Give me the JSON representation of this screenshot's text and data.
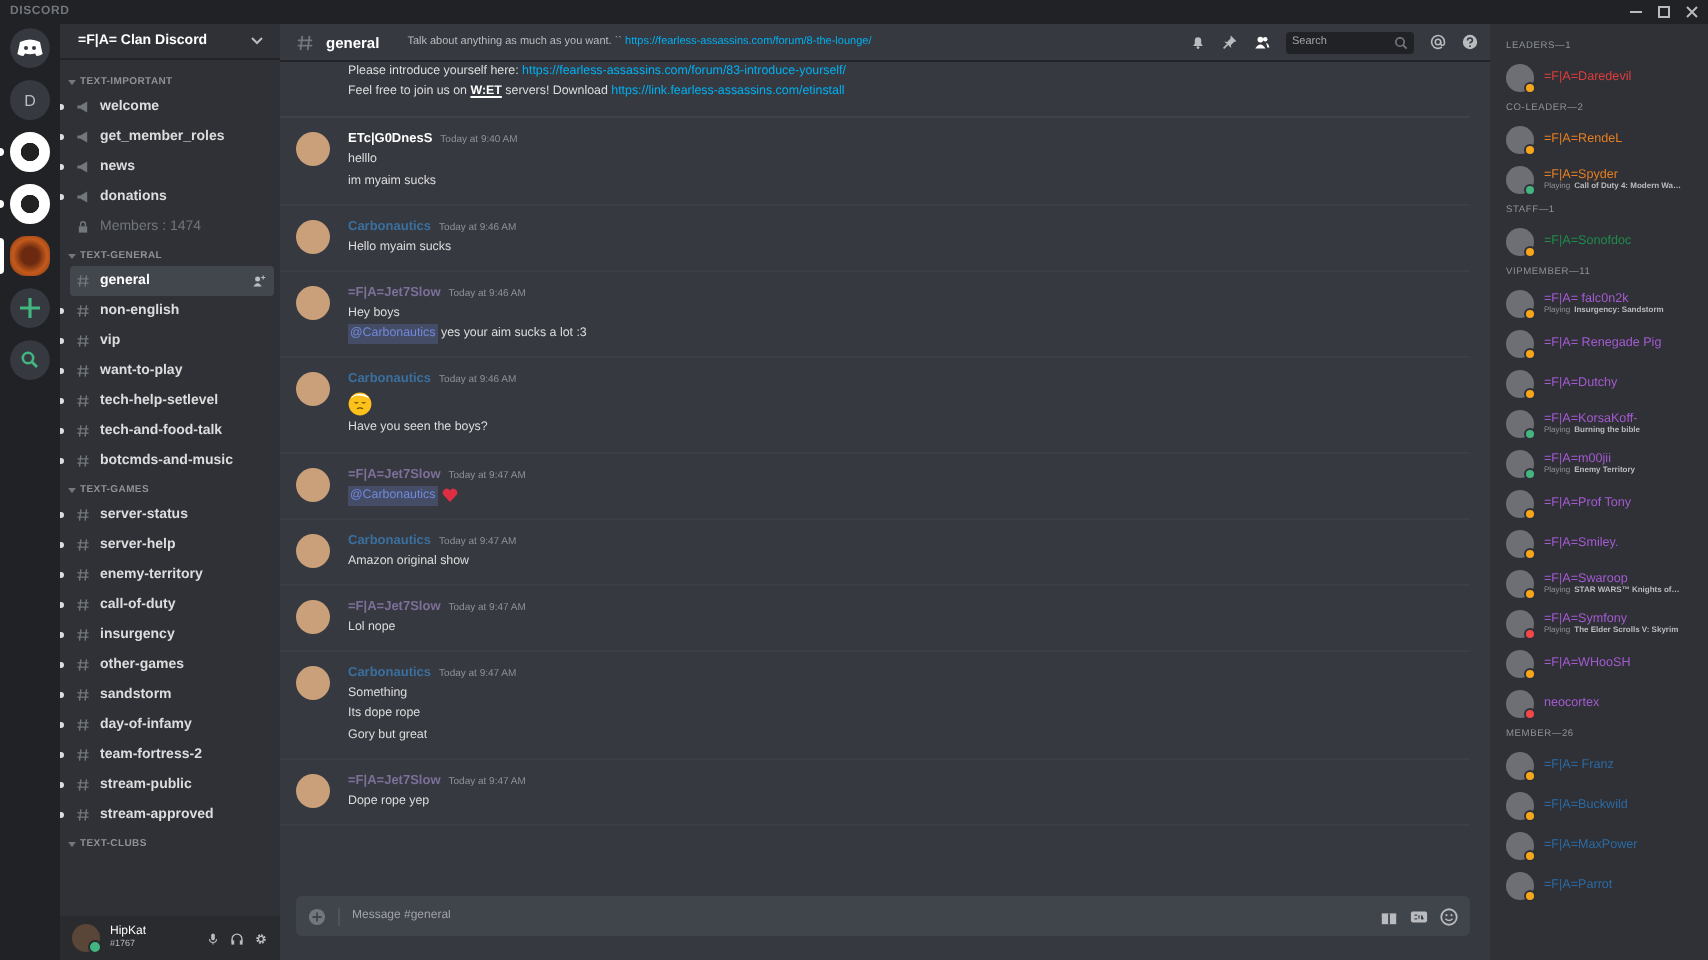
{
  "app_title": "DISCORD",
  "servers": [
    {
      "kind": "home"
    },
    {
      "kind": "letter",
      "label": "D"
    },
    {
      "kind": "image",
      "selected": false,
      "unread": true
    },
    {
      "kind": "image",
      "selected": false,
      "unread": true
    },
    {
      "kind": "image",
      "selected": true
    },
    {
      "kind": "add"
    },
    {
      "kind": "explore"
    }
  ],
  "guild": {
    "name": "=F|A= Clan Discord"
  },
  "categories": [
    {
      "label": "TEXT-IMPORTANT",
      "channels": [
        {
          "kind": "announcement",
          "name": "welcome",
          "selected": false,
          "unread": true
        },
        {
          "kind": "announcement",
          "name": "get_member_roles",
          "selected": false,
          "unread": true
        },
        {
          "kind": "announcement",
          "name": "news",
          "selected": false,
          "unread": true
        },
        {
          "kind": "announcement",
          "name": "donations",
          "selected": false,
          "unread": true
        },
        {
          "kind": "locked",
          "name": "Members : 1474",
          "selected": false,
          "unread": false
        }
      ]
    },
    {
      "label": "TEXT-GENERAL",
      "channels": [
        {
          "kind": "text",
          "name": "general",
          "selected": true,
          "unread": false
        },
        {
          "kind": "text",
          "name": "non-english",
          "selected": false,
          "unread": true
        },
        {
          "kind": "text",
          "name": "vip",
          "selected": false,
          "unread": true
        },
        {
          "kind": "text",
          "name": "want-to-play",
          "selected": false,
          "unread": true
        },
        {
          "kind": "text",
          "name": "tech-help-setlevel",
          "selected": false,
          "unread": true
        },
        {
          "kind": "text",
          "name": "tech-and-food-talk",
          "selected": false,
          "unread": true
        },
        {
          "kind": "text",
          "name": "botcmds-and-music",
          "selected": false,
          "unread": true
        }
      ]
    },
    {
      "label": "TEXT-GAMES",
      "channels": [
        {
          "kind": "text",
          "name": "server-status",
          "selected": false,
          "unread": true
        },
        {
          "kind": "text",
          "name": "server-help",
          "selected": false,
          "unread": true
        },
        {
          "kind": "text",
          "name": "enemy-territory",
          "selected": false,
          "unread": true
        },
        {
          "kind": "text",
          "name": "call-of-duty",
          "selected": false,
          "unread": true
        },
        {
          "kind": "text",
          "name": "insurgency",
          "selected": false,
          "unread": true
        },
        {
          "kind": "text",
          "name": "other-games",
          "selected": false,
          "unread": true
        },
        {
          "kind": "text",
          "name": "sandstorm",
          "selected": false,
          "unread": true
        },
        {
          "kind": "text",
          "name": "day-of-infamy",
          "selected": false,
          "unread": true
        },
        {
          "kind": "text",
          "name": "team-fortress-2",
          "selected": false,
          "unread": true
        },
        {
          "kind": "text",
          "name": "stream-public",
          "selected": false,
          "unread": true
        },
        {
          "kind": "text",
          "name": "stream-approved",
          "selected": false,
          "unread": true
        }
      ]
    },
    {
      "label": "TEXT-CLUBS"
    }
  ],
  "user_panel": {
    "name": "HipKat",
    "tag": "#1767",
    "status": {
      "color": "#43b581"
    }
  },
  "header": {
    "channel": "general",
    "topic": [
      {
        "kind": "text",
        "text": "Talk about anything as much as you want. `` "
      },
      {
        "kind": "link",
        "text": "https://fearless-assassins.com/forum/8-the-lounge/"
      }
    ],
    "search": {
      "placeholder": "Search"
    }
  },
  "top_lines": [
    [
      {
        "kind": "text",
        "text": "Please introduce yourself here: "
      },
      {
        "kind": "link",
        "text": "https://fearless-assassins.com/forum/83-introduce-yourself/"
      }
    ],
    [
      {
        "kind": "text",
        "text": "Feel free to join us on "
      },
      {
        "kind": "bold",
        "text": "W:ET"
      },
      {
        "kind": "text",
        "text": " servers! Download "
      },
      {
        "kind": "link",
        "text": "https://link.fearless-assassins.com/etinstall"
      }
    ]
  ],
  "messages": [
    {
      "author": "ETc|G0DnesS",
      "color": "#ffffff",
      "time": "Today at 9:40 AM",
      "lines": [
        [
          {
            "kind": "text",
            "text": "helllo"
          }
        ],
        [
          {
            "kind": "text",
            "text": "im myaim sucks"
          }
        ]
      ]
    },
    {
      "author": "Carbonautics",
      "color": "#3a6f9e",
      "time": "Today at 9:46 AM",
      "lines": [
        [
          {
            "kind": "text",
            "text": "Hello myaim sucks"
          }
        ]
      ]
    },
    {
      "author": "=F|A=Jet7Slow",
      "color": "#7e6f9a",
      "time": "Today at 9:46 AM",
      "lines": [
        [
          {
            "kind": "text",
            "text": "Hey boys"
          }
        ],
        [
          {
            "kind": "mention",
            "text": "@Carbonautics"
          },
          {
            "kind": "text",
            "text": " yes your aim sucks a lot :3"
          }
        ]
      ]
    },
    {
      "author": "Carbonautics",
      "color": "#3a6f9e",
      "time": "Today at 9:46 AM",
      "lines": [
        [
          {
            "kind": "face"
          }
        ],
        [
          {
            "kind": "text",
            "text": "Have you seen the boys?"
          }
        ]
      ]
    },
    {
      "author": "=F|A=Jet7Slow",
      "color": "#7e6f9a",
      "time": "Today at 9:47 AM",
      "lines": [
        [
          {
            "kind": "mention",
            "text": "@Carbonautics"
          },
          {
            "kind": "heart"
          }
        ]
      ]
    },
    {
      "author": "Carbonautics",
      "color": "#3a6f9e",
      "time": "Today at 9:47 AM",
      "lines": [
        [
          {
            "kind": "text",
            "text": "Amazon original show"
          }
        ]
      ]
    },
    {
      "author": "=F|A=Jet7Slow",
      "color": "#7e6f9a",
      "time": "Today at 9:47 AM",
      "lines": [
        [
          {
            "kind": "text",
            "text": "Lol nope"
          }
        ]
      ]
    },
    {
      "author": "Carbonautics",
      "color": "#3a6f9e",
      "time": "Today at 9:47 AM",
      "lines": [
        [
          {
            "kind": "text",
            "text": "Something"
          }
        ],
        [
          {
            "kind": "text",
            "text": "Its dope rope"
          }
        ],
        [
          {
            "kind": "text",
            "text": "Gory but great"
          }
        ]
      ]
    },
    {
      "author": "=F|A=Jet7Slow",
      "color": "#7e6f9a",
      "time": "Today at 9:47 AM",
      "lines": [
        [
          {
            "kind": "text",
            "text": "Dope rope yep"
          }
        ]
      ]
    }
  ],
  "composer": {
    "placeholder": "Message #general"
  },
  "member_groups": [
    {
      "title": "LEADERS—1",
      "members": [
        {
          "name": "=F|A=Daredevil",
          "color": "#e03c3c",
          "status": {
            "color": "#faa61a"
          }
        }
      ]
    },
    {
      "title": "CO-LEADER—2",
      "members": [
        {
          "name": "=F|A=RendeL",
          "color": "#e67e22",
          "status": {
            "color": "#faa61a"
          }
        },
        {
          "name": "=F|A=Spyder",
          "color": "#e67e22",
          "status": {
            "color": "#43b581"
          },
          "activity": {
            "verb": "Playing",
            "game": "Call of Duty 4: Modern Wa…"
          }
        }
      ]
    },
    {
      "title": "STAFF—1",
      "members": [
        {
          "name": "=F|A=Sonofdoc",
          "color": "#1f8b4c",
          "status": {
            "color": "#faa61a"
          }
        }
      ]
    },
    {
      "title": "VIPMEMBER—11",
      "members": [
        {
          "name": "=F|A= falc0n2k",
          "color": "#a35ad0",
          "status": {
            "color": "#faa61a"
          },
          "activity": {
            "verb": "Playing",
            "game": "Insurgency: Sandstorm"
          }
        },
        {
          "name": "=F|A= Renegade Pig",
          "color": "#a35ad0",
          "status": {
            "color": "#faa61a"
          }
        },
        {
          "name": "=F|A=Dutchy",
          "color": "#a35ad0",
          "status": {
            "color": "#faa61a"
          }
        },
        {
          "name": "=F|A=KorsaKoff-",
          "color": "#a35ad0",
          "status": {
            "color": "#43b581"
          },
          "activity": {
            "verb": "Playing",
            "game": "Burning the bible"
          }
        },
        {
          "name": "=F|A=m00jii",
          "color": "#a35ad0",
          "status": {
            "color": "#43b581"
          },
          "activity": {
            "verb": "Playing",
            "game": "Enemy Territory"
          }
        },
        {
          "name": "=F|A=Prof Tony",
          "color": "#a35ad0",
          "status": {
            "color": "#faa61a"
          }
        },
        {
          "name": "=F|A=Smiley.",
          "color": "#a35ad0",
          "status": {
            "color": "#faa61a"
          }
        },
        {
          "name": "=F|A=Swaroop",
          "color": "#a35ad0",
          "status": {
            "color": "#faa61a"
          },
          "activity": {
            "verb": "Playing",
            "game": "STAR WARS™ Knights of…"
          }
        },
        {
          "name": "=F|A=Symfony",
          "color": "#a35ad0",
          "status": {
            "color": "#f04747"
          },
          "activity": {
            "verb": "Playing",
            "game": "The Elder Scrolls V: Skyrim"
          }
        },
        {
          "name": "=F|A=WHooSH",
          "color": "#a35ad0",
          "status": {
            "color": "#faa61a"
          }
        },
        {
          "name": "neocortex",
          "color": "#a35ad0",
          "status": {
            "color": "#f04747"
          }
        }
      ]
    },
    {
      "title": "MEMBER—26",
      "members": [
        {
          "name": "=F|A= Franz",
          "color": "#2b6aa3",
          "status": {
            "color": "#faa61a"
          }
        },
        {
          "name": "=F|A=Buckwild",
          "color": "#2b6aa3",
          "status": {
            "color": "#faa61a"
          }
        },
        {
          "name": "=F|A=MaxPower",
          "color": "#2b6aa3",
          "status": {
            "color": "#faa61a"
          }
        },
        {
          "name": "=F|A=Parrot",
          "color": "#2b6aa3",
          "status": {
            "color": "#faa61a"
          }
        }
      ]
    }
  ]
}
